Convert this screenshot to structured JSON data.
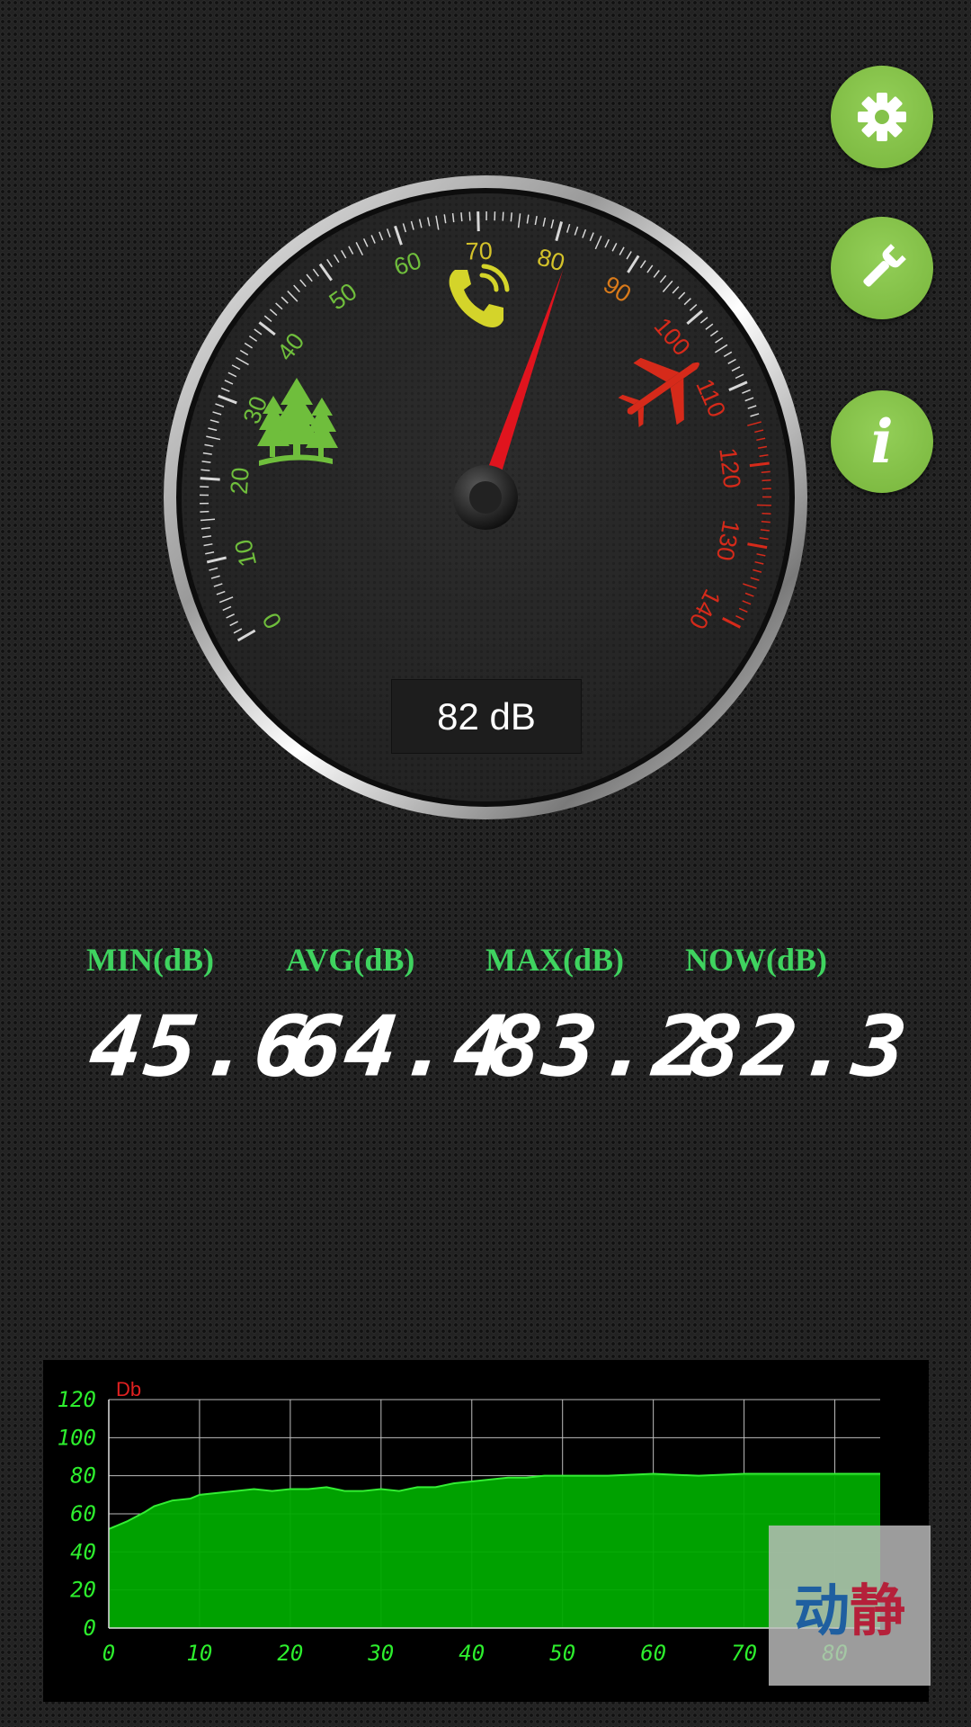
{
  "toolbar": {
    "settings_icon": "gear-icon",
    "tools_icon": "wrench-icon",
    "info_icon": "info-icon",
    "info_glyph": "i"
  },
  "gauge": {
    "value": 82,
    "readout": "82 dB",
    "min": 0,
    "max": 140,
    "major_ticks": [
      "0",
      "10",
      "20",
      "30",
      "40",
      "50",
      "60",
      "70",
      "80",
      "90",
      "100",
      "110",
      "120",
      "130",
      "140"
    ],
    "icons": [
      "trees-icon",
      "phone-icon",
      "airplane-icon"
    ],
    "colors": {
      "green": "#6fbe3c",
      "yellow": "#d4c22a",
      "orange": "#d97a1a",
      "red": "#d62a1a",
      "needle": "#e0141e"
    }
  },
  "stats": [
    {
      "label": "MIN(dB)",
      "value": "45.6"
    },
    {
      "label": "AVG(dB)",
      "value": "64.4"
    },
    {
      "label": "MAX(dB)",
      "value": "83.2"
    },
    {
      "label": "NOW(dB)",
      "value": "82.3"
    }
  ],
  "chart_data": {
    "type": "area",
    "ylabel": "Db",
    "xlim": [
      0,
      85
    ],
    "ylim": [
      0,
      120
    ],
    "xticks": [
      "0",
      "10",
      "20",
      "30",
      "40",
      "50",
      "60",
      "70",
      "80"
    ],
    "yticks": [
      "120",
      "100",
      "80",
      "60",
      "40",
      "20",
      "0"
    ],
    "grid": true,
    "series": [
      {
        "color": "#00aa00",
        "x": [
          0,
          2,
          4,
          5,
          7,
          9,
          10,
          12,
          14,
          16,
          18,
          20,
          22,
          24,
          26,
          28,
          30,
          32,
          34,
          36,
          38,
          40,
          42,
          44,
          46,
          48,
          50,
          55,
          60,
          65,
          70,
          75,
          80,
          85
        ],
        "y": [
          52,
          56,
          61,
          64,
          67,
          68,
          70,
          71,
          72,
          73,
          72,
          73,
          73,
          74,
          72,
          72,
          73,
          72,
          74,
          74,
          76,
          77,
          78,
          79,
          79,
          80,
          80,
          80,
          81,
          80,
          81,
          81,
          81,
          81
        ]
      }
    ]
  },
  "watermark": {
    "text_left": "动",
    "text_right": "静"
  }
}
